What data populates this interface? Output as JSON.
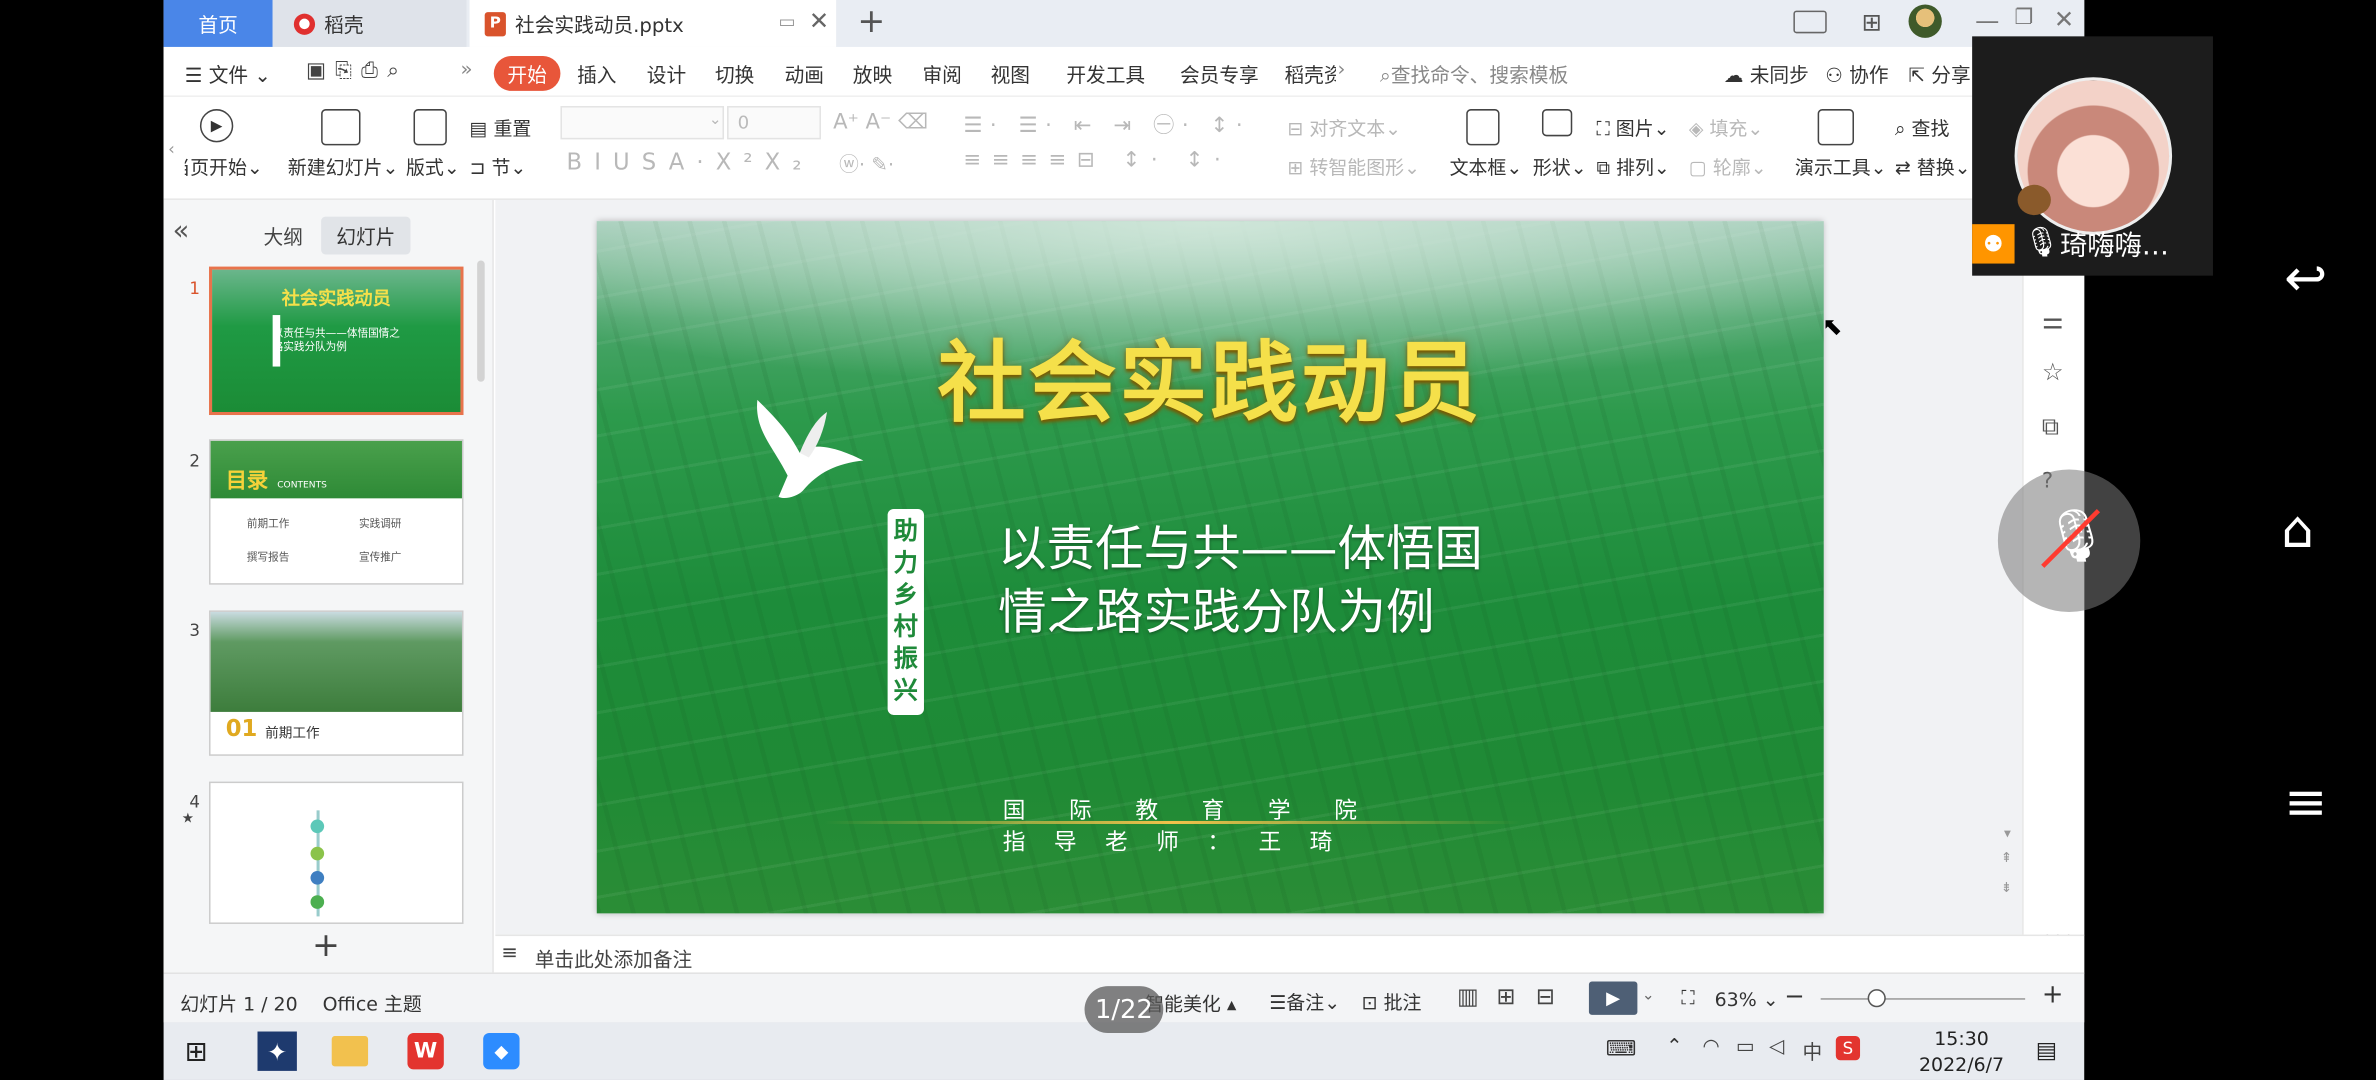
{
  "tabs": {
    "home": "首页",
    "daoke": "稻壳",
    "file": "社会实践动员.pptx",
    "file_icon": "P"
  },
  "menubar": {
    "file": "文件",
    "items": [
      "开始",
      "插入",
      "设计",
      "切换",
      "动画",
      "放映",
      "审阅",
      "视图",
      "开发工具",
      "会员专享",
      "稻壳资"
    ],
    "search": "查找命令、搜索模板",
    "sync": "未同步",
    "collab": "协作",
    "share": "分享"
  },
  "ribbon": {
    "from_current": "当页开始",
    "new_slide": "新建幻灯片",
    "layout": "版式",
    "reset": "重置",
    "section": "节",
    "font_size": "0",
    "align_text": "对齐文本",
    "to_smartart": "转智能图形",
    "textbox": "文本框",
    "shape": "形状",
    "picture": "图片",
    "fill": "填充",
    "arrange": "排列",
    "outline": "轮廓",
    "presenter": "演示工具",
    "find": "查找",
    "replace": "替换"
  },
  "leftpanel": {
    "tab_outline": "大纲",
    "tab_slides": "幻灯片",
    "numbers": [
      "1",
      "2",
      "3",
      "4"
    ],
    "thumb1": {
      "title": "社会实践动员",
      "sub": "以责任与共——体悟国情之路实践分队为例"
    },
    "thumb2": {
      "title": "目录",
      "contents": "CONTENTS",
      "items": [
        "前期工作",
        "实践调研",
        "撰写报告",
        "宣传推广"
      ]
    },
    "thumb3": {
      "num": "01",
      "label": "前期工作"
    }
  },
  "slide": {
    "title": "社会实践动员",
    "subtitle_l1": "以责任与共——体悟国",
    "subtitle_l2": "情之路实践分队为例",
    "badge": "助力乡村振兴",
    "org_l1": "国 际 教 育 学 院",
    "org_l2": "指 导 老 师 ： 王 琦"
  },
  "notes": {
    "placeholder": "单击此处添加备注"
  },
  "status": {
    "slide_count": "幻灯片 1 / 20",
    "theme": "Office 主题",
    "beautify": "智能美化",
    "notes": "备注",
    "comment": "批注",
    "zoom": "63%"
  },
  "taskbar": {
    "time": "15:30",
    "date": "2022/6/7",
    "ime": "中"
  },
  "overlay": {
    "counter": "1/22",
    "user": "琦嗨嗨…",
    "more": "•••"
  }
}
